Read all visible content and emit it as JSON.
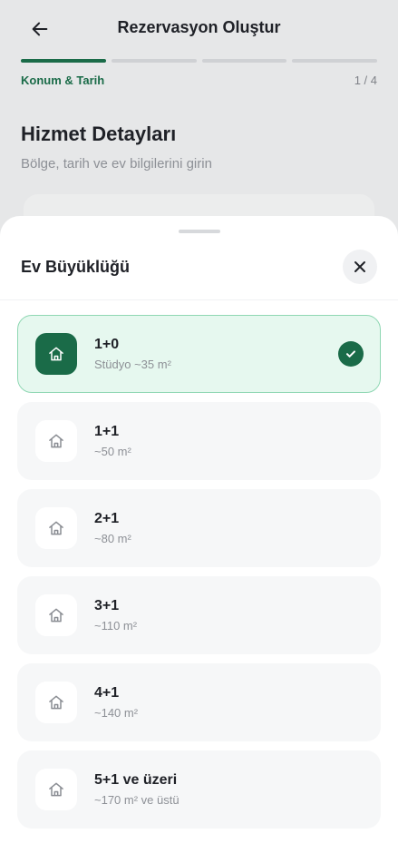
{
  "header": {
    "title": "Rezervasyon Oluştur",
    "back_icon": "arrow-left-icon"
  },
  "progress": {
    "total_steps": 4,
    "current_step": 1,
    "step_label": "Konum & Tarih",
    "step_count": "1 / 4"
  },
  "page": {
    "title": "Hizmet Detayları",
    "subtitle": "Bölge, tarih ve ev bilgilerini girin"
  },
  "sheet": {
    "title": "Ev Büyüklüğü",
    "close_icon": "close-icon",
    "options": [
      {
        "label": "1+0",
        "detail": "Stüdyo ~35 m²",
        "selected": true,
        "icon": "home-icon"
      },
      {
        "label": "1+1",
        "detail": "~50 m²",
        "selected": false,
        "icon": "home-icon"
      },
      {
        "label": "2+1",
        "detail": "~80 m²",
        "selected": false,
        "icon": "home-icon"
      },
      {
        "label": "3+1",
        "detail": "~110 m²",
        "selected": false,
        "icon": "home-icon"
      },
      {
        "label": "4+1",
        "detail": "~140 m²",
        "selected": false,
        "icon": "home-icon"
      },
      {
        "label": "5+1 ve üzeri",
        "detail": "~170 m² ve üstü",
        "selected": false,
        "icon": "home-icon"
      }
    ]
  },
  "colors": {
    "accent": "#1a6b48",
    "selected_bg": "#e6f8ef",
    "selected_border": "#8fd7b3",
    "option_bg": "#f6f7f8",
    "text_primary": "#1f2127",
    "text_secondary": "#8d9096"
  }
}
